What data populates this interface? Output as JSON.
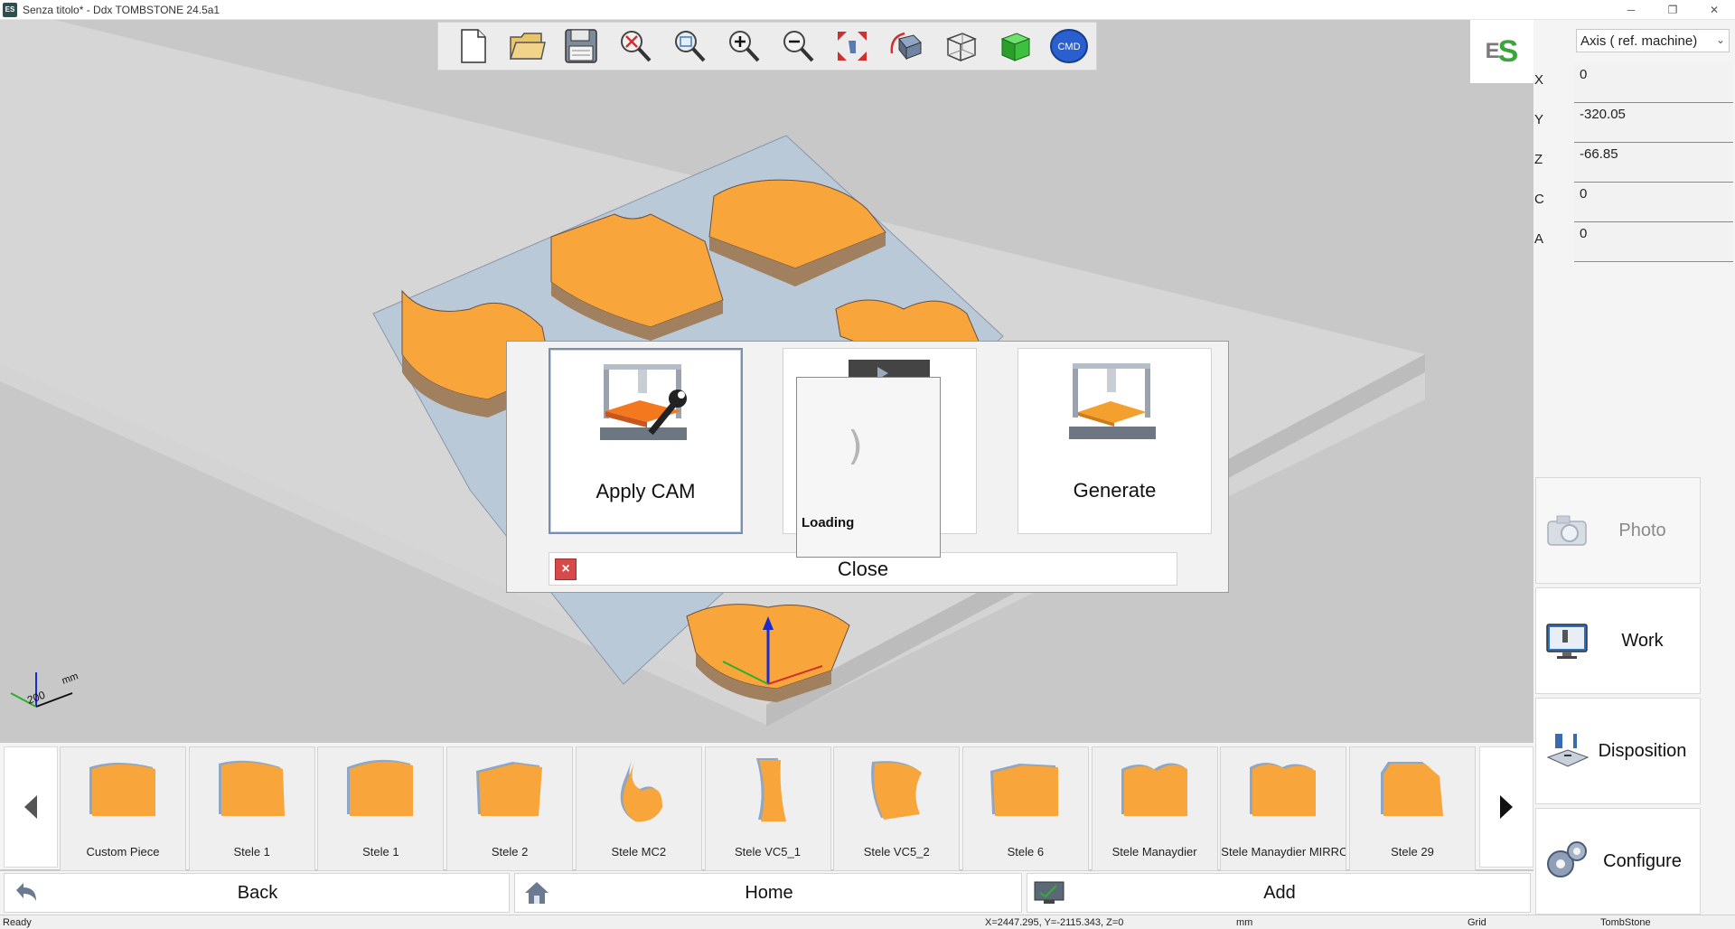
{
  "window": {
    "app_icon_text": "ES",
    "title": "Senza titolo* - Ddx TOMBSTONE 24.5a1",
    "minimize": "─",
    "restore": "❐",
    "close": "✕"
  },
  "toolbar": {
    "buttons": [
      {
        "icon": "new-document-icon"
      },
      {
        "icon": "open-folder-icon"
      },
      {
        "icon": "save-icon"
      },
      {
        "icon": "zoom-reset-icon"
      },
      {
        "icon": "zoom-window-icon"
      },
      {
        "icon": "zoom-in-icon"
      },
      {
        "icon": "zoom-out-icon"
      },
      {
        "icon": "zoom-extents-icon"
      },
      {
        "icon": "rotate-view-icon"
      },
      {
        "icon": "wireframe-view-icon"
      },
      {
        "icon": "solid-view-icon"
      },
      {
        "icon": "cmd-icon",
        "label": "CMD"
      }
    ]
  },
  "logo": {
    "e": "E",
    "s": "S"
  },
  "axis_panel": {
    "selector": "Axis ( ref. machine)",
    "coords": [
      {
        "label": "X",
        "value": "0"
      },
      {
        "label": "Y",
        "value": "-320.05"
      },
      {
        "label": "Z",
        "value": "-66.85"
      },
      {
        "label": "C",
        "value": "0"
      },
      {
        "label": "A",
        "value": "0"
      }
    ]
  },
  "side_buttons": [
    {
      "label": "Photo",
      "icon": "camera-icon",
      "enabled": false
    },
    {
      "label": "Work",
      "icon": "monitor-icon",
      "enabled": true
    },
    {
      "label": "Disposition",
      "icon": "disposition-icon",
      "enabled": true
    },
    {
      "label": "Configure",
      "icon": "gears-icon",
      "enabled": true
    }
  ],
  "dialog": {
    "cards": [
      {
        "label": "Apply CAM",
        "icon": "apply-cam-icon",
        "selected": true
      },
      {
        "label": "",
        "icon": "simulation-icon",
        "selected": false
      },
      {
        "label": "Generate",
        "icon": "generate-icon",
        "selected": false
      }
    ],
    "loading": "Loading",
    "close_label": "Close"
  },
  "scene": {
    "axis_unit": "mm",
    "axis_value": "200"
  },
  "pieces": [
    {
      "label": "Custom Piece",
      "shape": "custom"
    },
    {
      "label": "Stele 1",
      "shape": "stele-a"
    },
    {
      "label": "Stele 1",
      "shape": "stele-b"
    },
    {
      "label": "Stele 2",
      "shape": "stele-c"
    },
    {
      "label": "Stele MC2",
      "shape": "flame"
    },
    {
      "label": "Stele VC5_1",
      "shape": "vc51"
    },
    {
      "label": "Stele VC5_2",
      "shape": "vc52"
    },
    {
      "label": "Stele 6",
      "shape": "stele-6"
    },
    {
      "label": "Stele Manaydier",
      "shape": "stele-m"
    },
    {
      "label": "Stele Manaydier MIRROR",
      "shape": "stele-mm"
    },
    {
      "label": "Stele 29",
      "shape": "stele-29"
    }
  ],
  "nav": {
    "back": "Back",
    "home": "Home",
    "add": "Add"
  },
  "status": {
    "ready": "Ready",
    "coords": "X=2447.295, Y=-2115.343, Z=0",
    "unit": "mm",
    "grid": "Grid",
    "app": "TombStone"
  },
  "colors": {
    "piece_orange": "#f8a53c",
    "piece_side": "#a0805e",
    "accent_green": "#3aa53a",
    "close_red": "#d84a4a"
  }
}
